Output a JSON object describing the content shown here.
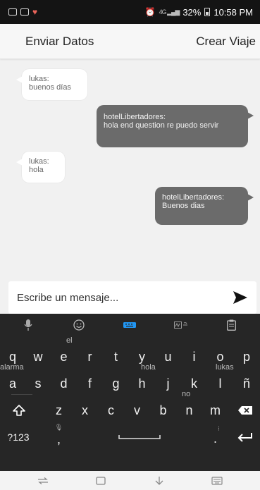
{
  "status_bar": {
    "battery": "32%",
    "time": "10:58 PM",
    "signal": "4G",
    "icons": [
      "gallery-icon",
      "photo-icon",
      "heart-icon",
      "alarm-icon",
      "signal-icon",
      "battery-icon"
    ]
  },
  "header": {
    "left_action": "Enviar Datos",
    "right_action": "Crear Viaje"
  },
  "messages": [
    {
      "direction": "in",
      "sender": "lukas:",
      "text": "buenos días"
    },
    {
      "direction": "out",
      "sender": "hotelLibertadores:",
      "text": "hola end question re puedo servir"
    },
    {
      "direction": "in",
      "sender": "lukas:",
      "text": "hola"
    },
    {
      "direction": "out",
      "sender": "hotelLibertadores:",
      "text": "Buenos dias"
    }
  ],
  "composer": {
    "placeholder": "Escribe un mensaje...",
    "send_icon": "send-icon"
  },
  "keyboard": {
    "toolbar": [
      "mic-icon",
      "emoji-icon",
      "keyboard-icon",
      "handwriting-icon",
      "clipboard-icon"
    ],
    "accent_color": "#2196f3",
    "row1": [
      "q",
      "w",
      "e",
      "r",
      "t",
      "y",
      "u",
      "i",
      "o",
      "p"
    ],
    "row2": [
      "a",
      "s",
      "d",
      "f",
      "g",
      "h",
      "j",
      "k",
      "l",
      "ñ"
    ],
    "row3": [
      "z",
      "x",
      "c",
      "v",
      "b",
      "n",
      "m"
    ],
    "suggestions": {
      "e": "el",
      "a": "alarma",
      "h": "hola",
      "l": "lukas",
      "n": "no"
    },
    "symbols_key": "?123",
    "comma": ",",
    "period": "."
  },
  "nav_bar": {
    "icons": [
      "recents-icon",
      "home-icon",
      "hide-keyboard-icon",
      "keyboard-switch-icon"
    ]
  },
  "colors": {
    "status_bar": "#141414",
    "incoming_bubble": "#ffffff",
    "outgoing_bubble": "#6b6b6b",
    "keyboard_bg": "#262626"
  }
}
